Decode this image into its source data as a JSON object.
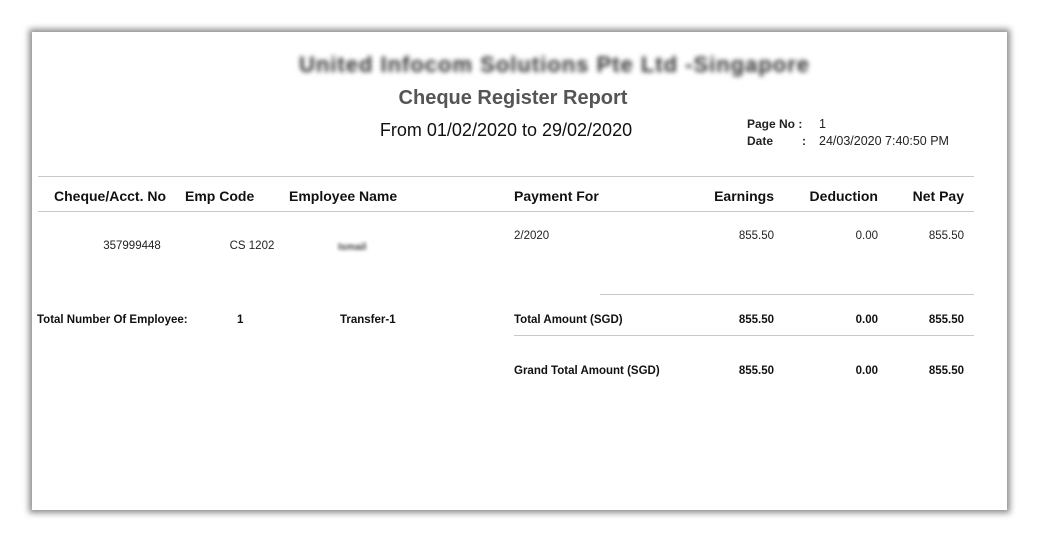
{
  "report": {
    "company_name": "United Infocom Solutions Pte Ltd -Singapore",
    "title": "Cheque Register Report",
    "period": "From 01/02/2020 to 29/02/2020",
    "page_no_label": "Page No :",
    "page_no_value": "1",
    "date_label": "Date",
    "date_colon": ":",
    "date_value": "24/03/2020 7:40:50 PM"
  },
  "table": {
    "columns": [
      "Cheque/Acct. No",
      "Emp Code",
      "Employee Name",
      "Payment For",
      "Earnings",
      "Deduction",
      "Net Pay"
    ],
    "rows": [
      {
        "account_no": "357999448",
        "emp_code": "CS 1202",
        "employee_name": "Ismail",
        "payment_for": "2/2020",
        "earnings": "855.50",
        "deduction": "0.00",
        "net_pay": "855.50"
      }
    ]
  },
  "totals": {
    "employee_count_label": "Total Number Of Employee:",
    "employee_count": "1",
    "transfer_label": "Transfer-1",
    "total_label": "Total Amount (SGD)",
    "total_earnings": "855.50",
    "total_deduction": "0.00",
    "total_net_pay": "855.50",
    "grand_total_label": "Grand Total Amount (SGD)",
    "grand_earnings": "855.50",
    "grand_deduction": "0.00",
    "grand_net_pay": "855.50"
  }
}
